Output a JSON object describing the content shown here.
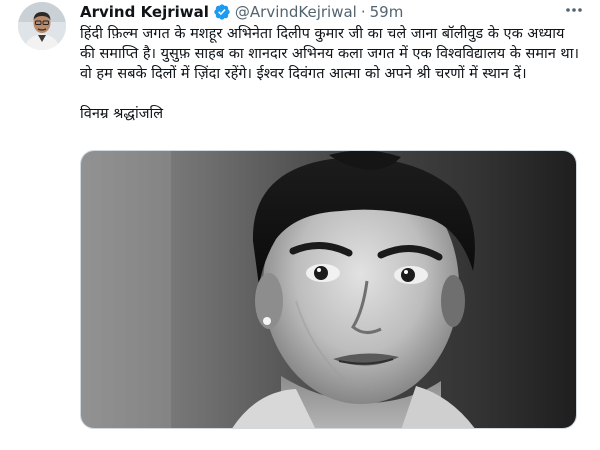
{
  "author": {
    "name": "Arvind Kejriwal",
    "handle": "@ArvindKejriwal",
    "separator": "·",
    "time": "59m",
    "verified": true,
    "verified_icon": "verified-badge-icon",
    "avatar_icon": "profile-avatar"
  },
  "tweet": {
    "body": "हिंदी फ़िल्म जगत के मशहूर अभिनेता दिलीप कुमार जी का चले जाना बॉलीवुड के एक अध्याय की समाप्ति है। युसुफ़ साहब का शानदार अभिनय कला जगत में एक विश्वविद्यालय के समान था। वो हम सबके दिलों में ज़िंदा रहेंगे। ईश्वर दिवंगत आत्मा को अपने श्री चरणों में स्थान दें।",
    "tribute": "विनम्र श्रद्धांजलि"
  },
  "media": {
    "type": "black-and-white portrait photo"
  },
  "icons": {
    "more": "more-options-icon"
  },
  "colors": {
    "verified": "#1d9bf0",
    "secondary_text": "#536471",
    "primary_text": "#0f1419"
  }
}
